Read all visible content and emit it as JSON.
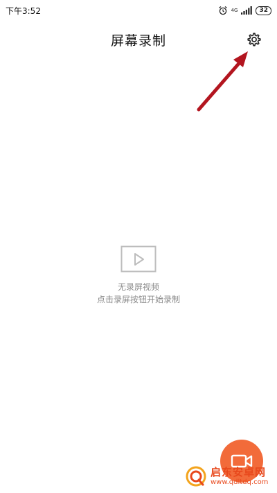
{
  "status_bar": {
    "time": "下午3:52",
    "network": "4G",
    "battery": "32",
    "icons": [
      "alarm-icon",
      "signal-icon",
      "battery-icon"
    ]
  },
  "header": {
    "title": "屏幕录制",
    "settings_icon": "gear-icon"
  },
  "empty_state": {
    "icon": "video-play-icon",
    "title": "无录屏视频",
    "hint": "点击录屏按钮开始录制"
  },
  "fab": {
    "icon": "video-camera-icon",
    "color": "#f26b3a"
  },
  "watermark": {
    "name": "启东安卓网",
    "url": "www.qdltdq.com"
  },
  "colors": {
    "accent": "#f26b3a",
    "annotation": "#b3151f",
    "muted_text": "#8a8a8a"
  }
}
